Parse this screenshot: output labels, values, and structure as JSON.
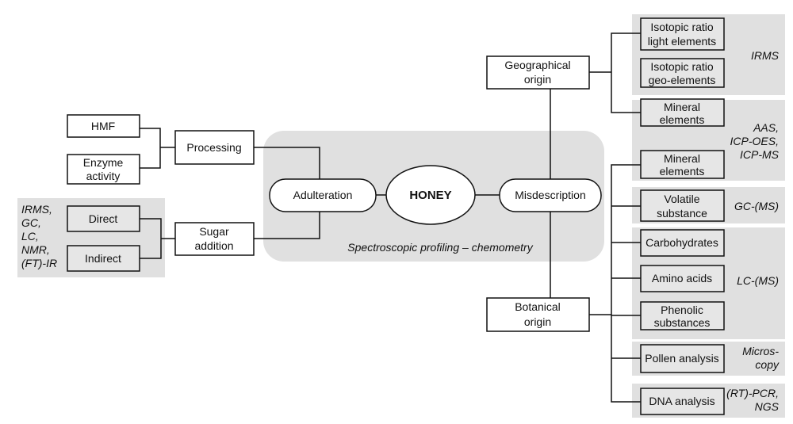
{
  "center": {
    "label": "HONEY"
  },
  "footer_note": "Spectroscopic profiling – chemometry",
  "left": {
    "adulteration": "Adulteration",
    "processing": "Processing",
    "hmf": "HMF",
    "enzyme": [
      "Enzyme",
      "activity"
    ],
    "sugar_addition": [
      "Sugar",
      "addition"
    ],
    "direct": "Direct",
    "indirect": "Indirect",
    "sugar_methods": [
      "IRMS,",
      "GC,",
      "LC,",
      "NMR,",
      "(FT)-IR"
    ]
  },
  "right": {
    "misdescription": "Misdescription",
    "geographical": [
      "Geographical",
      "origin"
    ],
    "botanical": [
      "Botanical",
      "origin"
    ],
    "iso_light": [
      "Isotopic ratio",
      "light elements"
    ],
    "iso_geo": [
      "Isotopic ratio",
      "geo-elements"
    ],
    "mineral_geo": [
      "Mineral",
      "elements"
    ],
    "mineral_bot": [
      "Mineral",
      "elements"
    ],
    "volatile": [
      "Volatile",
      "substance"
    ],
    "carbohydrates": "Carbohydrates",
    "amino": "Amino acids",
    "phenolic": [
      "Phenolic",
      "substances"
    ],
    "pollen": "Pollen analysis",
    "dna": "DNA analysis",
    "methods": {
      "irms": "IRMS",
      "aas": [
        "AAS,",
        "ICP-OES,",
        "ICP-MS"
      ],
      "gc": "GC-(MS)",
      "lc": "LC-(MS)",
      "micro": [
        "Micros-",
        "copy"
      ],
      "pcr": [
        "(RT)-PCR,",
        "NGS"
      ]
    }
  },
  "colors": {
    "panel": "#e0e0e0",
    "line": "#111111"
  }
}
